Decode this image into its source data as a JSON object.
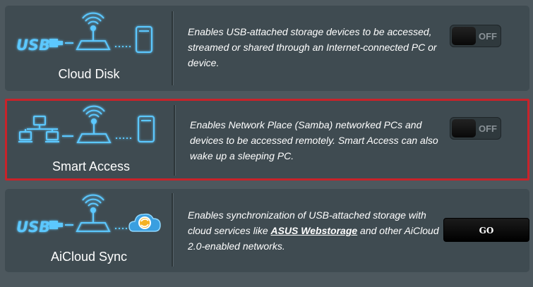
{
  "features": [
    {
      "name": "Cloud Disk",
      "icon_left": "usb-logo-icon",
      "description": "Enables USB-attached storage devices to be accessed, streamed or shared through an Internet-connected PC or device.",
      "control": {
        "type": "toggle",
        "state": "OFF"
      }
    },
    {
      "name": "Smart Access",
      "icon_left": "network-pcs-icon",
      "description": "Enables Network Place (Samba) networked PCs and devices to be accessed remotely. Smart Access can also wake up a sleeping PC.",
      "highlighted": true,
      "highlight_color": "#c8232a",
      "control": {
        "type": "toggle",
        "state": "OFF"
      }
    },
    {
      "name": "AiCloud Sync",
      "icon_left": "usb-logo-icon",
      "description_before": "Enables synchronization of USB-attached storage with cloud services like ",
      "description_link": "ASUS Webstorage",
      "description_after": " and other AiCloud 2.0-enabled networks.",
      "control": {
        "type": "button",
        "label": "GO"
      }
    }
  ],
  "colors": {
    "page_bg": "#4d585e",
    "panel_bg": "#3f4b51",
    "icon_glow": "#5cc8ff"
  }
}
